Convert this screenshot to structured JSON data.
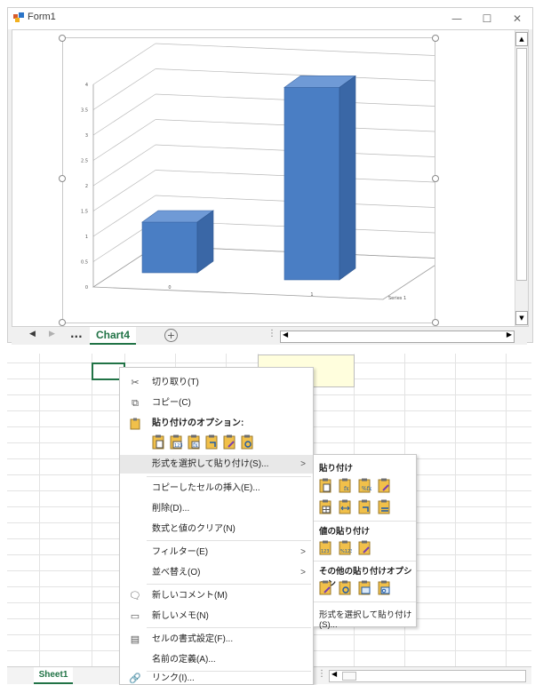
{
  "window": {
    "title": "Form1",
    "min_glyph": "—",
    "max_glyph": "☐",
    "close_glyph": "✕"
  },
  "chart_data": {
    "type": "bar",
    "categories": [
      "0",
      "1"
    ],
    "series": [
      {
        "name": "Series 1",
        "values": [
          1,
          3.8
        ]
      }
    ],
    "ylim": [
      0,
      4
    ],
    "yticks": [
      "0",
      "0.5",
      "1",
      "1.5",
      "2",
      "2.5",
      "3",
      "3.5",
      "4"
    ],
    "grid": true,
    "projection": "3d",
    "bar_color": "#4a7ec4"
  },
  "sheet_tabs": {
    "prev_glyph": "◀",
    "next_glyph": "▶",
    "ellipsis": "...",
    "active": "Chart4",
    "add_glyph": "+"
  },
  "excel": {
    "sheet_tab": "Sheet1"
  },
  "context_menu": {
    "items": [
      {
        "label": "切り取り(T)",
        "icon": "scissors-icon"
      },
      {
        "label": "コピー(C)",
        "icon": "copy-icon"
      },
      {
        "label": "貼り付けのオプション:",
        "icon": "paste-icon"
      },
      {
        "label": "形式を選択して貼り付け(S)..."
      },
      {
        "label": "コピーしたセルの挿入(E)..."
      },
      {
        "label": "削除(D)..."
      },
      {
        "label": "数式と値のクリア(N)"
      },
      {
        "label": "フィルター(E)"
      },
      {
        "label": "並べ替え(O)"
      },
      {
        "label": "新しいコメント(M)",
        "icon": "comment-icon"
      },
      {
        "label": "新しいメモ(N)",
        "icon": "note-icon"
      },
      {
        "label": "セルの書式設定(F)...",
        "icon": "format-cells-icon"
      },
      {
        "label": "名前の定義(A)..."
      },
      {
        "label": "リンク(I)...",
        "icon": "link-icon"
      }
    ],
    "submenu_arrow": ">"
  },
  "submenu": {
    "paste_header": "貼り付け",
    "values_header": "値の貼り付け",
    "other_header": "その他の貼り付けオプション",
    "paste_special": "形式を選択して貼り付け(S)..."
  }
}
